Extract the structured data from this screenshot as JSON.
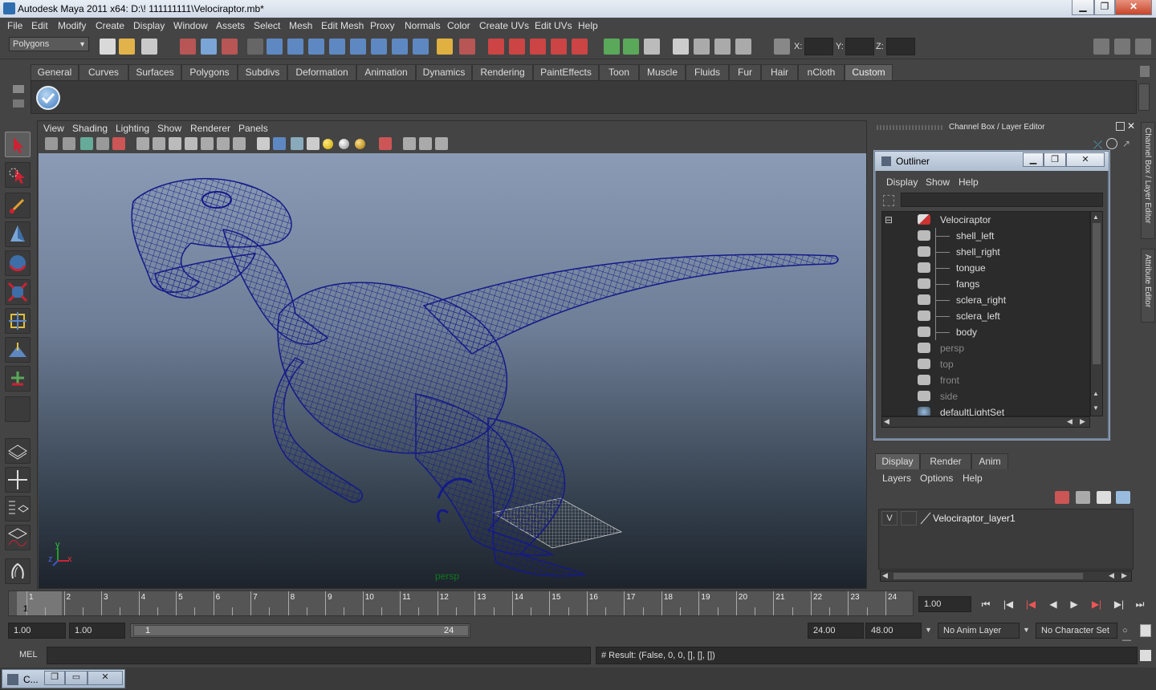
{
  "window": {
    "title": "Autodesk Maya 2011 x64: D:\\! 111111111\\Velociraptor.mb*",
    "minimize": "▁",
    "restore": "❐",
    "close": "✕"
  },
  "menubar": [
    "File",
    "Edit",
    "Modify",
    "Create",
    "Display",
    "Window",
    "Assets",
    "Select",
    "Mesh",
    "Edit Mesh",
    "Proxy",
    "Normals",
    "Color",
    "Create UVs",
    "Edit UVs",
    "Help"
  ],
  "statusline": {
    "mode": "Polygons",
    "x_label": "X:",
    "y_label": "Y:",
    "z_label": "Z:"
  },
  "shelf": {
    "tabs": [
      "General",
      "Curves",
      "Surfaces",
      "Polygons",
      "Subdivs",
      "Deformation",
      "Animation",
      "Dynamics",
      "Rendering",
      "PaintEffects",
      "Toon",
      "Muscle",
      "Fluids",
      "Fur",
      "Hair",
      "nCloth",
      "Custom"
    ],
    "active_tab": "Custom"
  },
  "viewport": {
    "menu": [
      "View",
      "Shading",
      "Lighting",
      "Show",
      "Renderer",
      "Panels"
    ],
    "camera_label": "persp",
    "axis_y": "y",
    "axis_x": "x",
    "axis_z": "z"
  },
  "channel_box": {
    "title": "Channel Box / Layer Editor"
  },
  "side_tabs": [
    "Channel Box / Layer Editor",
    "Attribute Editor"
  ],
  "outliner": {
    "title": "Outliner",
    "menu": [
      "Display",
      "Show",
      "Help"
    ],
    "expander": "⊟",
    "items": [
      {
        "name": "Velociraptor",
        "level": 0,
        "dim": false
      },
      {
        "name": "shell_left",
        "level": 1,
        "dim": false
      },
      {
        "name": "shell_right",
        "level": 1,
        "dim": false
      },
      {
        "name": "tongue",
        "level": 1,
        "dim": false
      },
      {
        "name": "fangs",
        "level": 1,
        "dim": false
      },
      {
        "name": "sclera_right",
        "level": 1,
        "dim": false
      },
      {
        "name": "sclera_left",
        "level": 1,
        "dim": false
      },
      {
        "name": "body",
        "level": 1,
        "dim": false
      },
      {
        "name": "persp",
        "level": 0,
        "dim": true
      },
      {
        "name": "top",
        "level": 0,
        "dim": true
      },
      {
        "name": "front",
        "level": 0,
        "dim": true
      },
      {
        "name": "side",
        "level": 0,
        "dim": true
      },
      {
        "name": "defaultLightSet",
        "level": 0,
        "dim": false
      }
    ]
  },
  "layer_editor": {
    "tabs": [
      "Display",
      "Render",
      "Anim"
    ],
    "active_tab": "Display",
    "menu": [
      "Layers",
      "Options",
      "Help"
    ],
    "layer": {
      "visibility": "V",
      "name": "Velociraptor_layer1"
    }
  },
  "timeline": {
    "ticks": [
      "1",
      "2",
      "3",
      "4",
      "5",
      "6",
      "7",
      "8",
      "9",
      "10",
      "11",
      "12",
      "13",
      "14",
      "15",
      "16",
      "17",
      "18",
      "19",
      "20",
      "21",
      "22",
      "23",
      "24"
    ],
    "current_frame_marker": "1",
    "current_time": "1.00",
    "playback": [
      "⏮",
      "|◀",
      "|◀",
      "◀",
      "▶",
      "▶|",
      "▶|",
      "⏭"
    ]
  },
  "range": {
    "start": "1.00",
    "anim_start": "1.00",
    "slider_start": "1",
    "slider_end": "24",
    "anim_end": "24.00",
    "end": "48.00",
    "anim_layer": "No Anim Layer",
    "character_set": "No Character Set"
  },
  "command": {
    "label": "MEL",
    "result": "# Result: (False, 0, 0, [], [], [])"
  },
  "taskbar": {
    "item": "C..."
  },
  "colors": {
    "wireframe": "#1a1f8a",
    "viewport_top": "#8b9bb5",
    "viewport_bottom": "#1d232b",
    "panel_bg": "#444444"
  }
}
